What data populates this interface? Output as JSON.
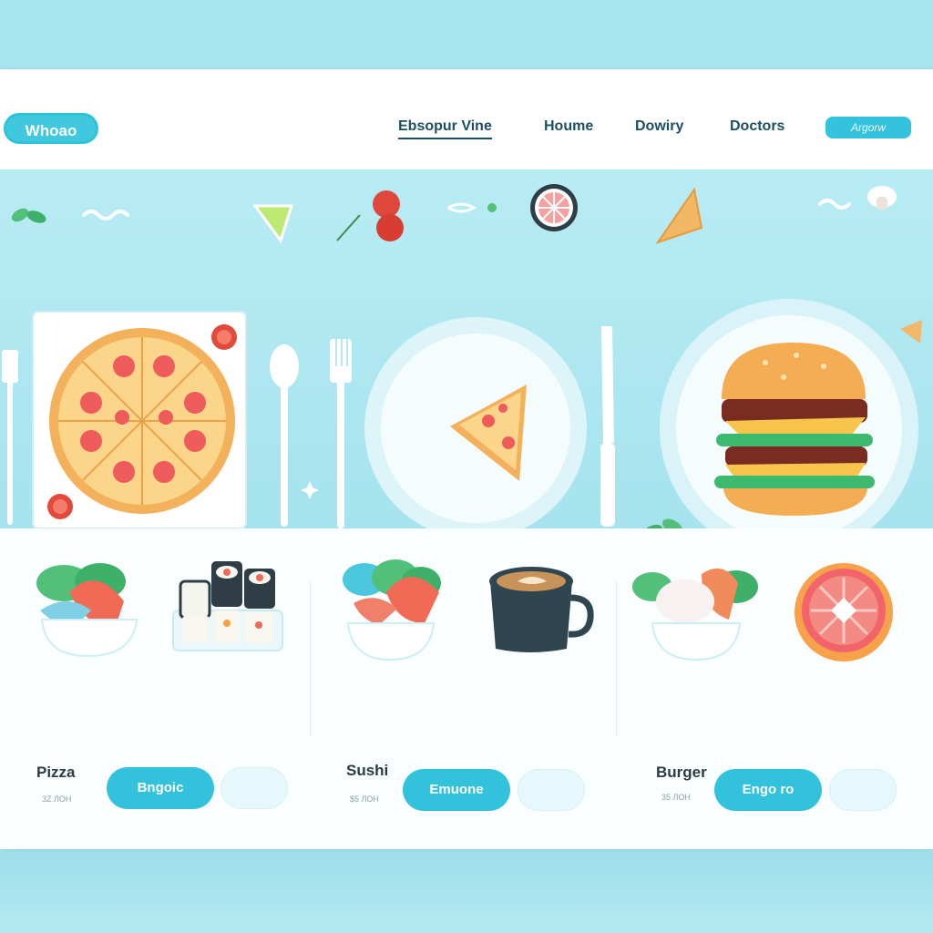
{
  "header": {
    "logo": "Whoao",
    "nav": [
      {
        "label": "Ebsopur Vine",
        "active": true
      },
      {
        "label": "Houme",
        "active": false
      },
      {
        "label": "Dowiry",
        "active": false
      },
      {
        "label": "Doctors",
        "active": false
      }
    ],
    "cta_label": "Argorw"
  },
  "products": [
    {
      "name": "Pizza",
      "price": "3Z ЛОН",
      "button": "Bngoic"
    },
    {
      "name": "Sushi",
      "price": "$5 ЛОН",
      "button": "Emuone"
    },
    {
      "name": "Burger",
      "price": "35 ЛОН",
      "button": "Engo ro"
    }
  ],
  "colors": {
    "accent": "#33c2dc",
    "hero_bg": "#aee6f0",
    "text_dark": "#1d4f63"
  }
}
